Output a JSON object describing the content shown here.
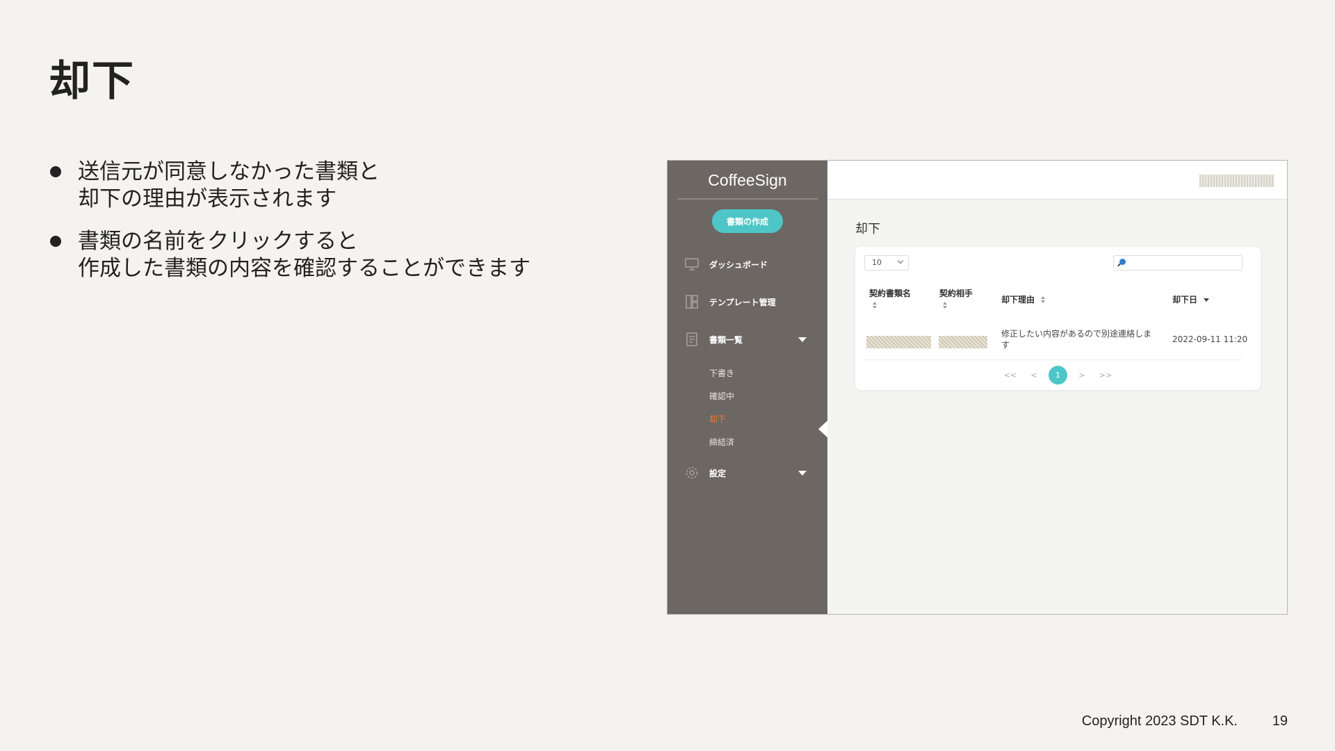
{
  "slide": {
    "title": "却下",
    "bullets": [
      {
        "lines": [
          "送信元が同意しなかった書類と",
          "却下の理由が表示されます"
        ]
      },
      {
        "lines": [
          "書類の名前をクリックすると",
          "作成した書類の内容を確認することができます"
        ]
      }
    ],
    "copyright": "Copyright 2023 SDT K.K.",
    "page_number": "19"
  },
  "app": {
    "brand": "CoffeeSign",
    "create_button": "書類の作成",
    "nav": {
      "dashboard": "ダッシュボード",
      "templates": "テンプレート管理",
      "documents": "書類一覧",
      "settings": "設定"
    },
    "subnav": {
      "draft": "下書き",
      "confirming": "確認中",
      "rejected": "却下",
      "concluded": "締結済"
    },
    "page_heading": "却下",
    "table": {
      "page_size": "10",
      "columns": [
        "契約書類名",
        "契約相手",
        "却下理由",
        "却下日"
      ],
      "rows": [
        {
          "reason_line1": "修正したい内容があるので別途連絡しま",
          "reason_line2": "す",
          "date": "2022-09-11 11:20"
        }
      ]
    },
    "pagination": {
      "first": "<<",
      "prev": "<",
      "current": "1",
      "next": ">",
      "last": ">>"
    },
    "colors": {
      "sidebar": "#6c6762",
      "accent": "#4ec6c8",
      "active_subnav": "#ef7a3c"
    }
  }
}
